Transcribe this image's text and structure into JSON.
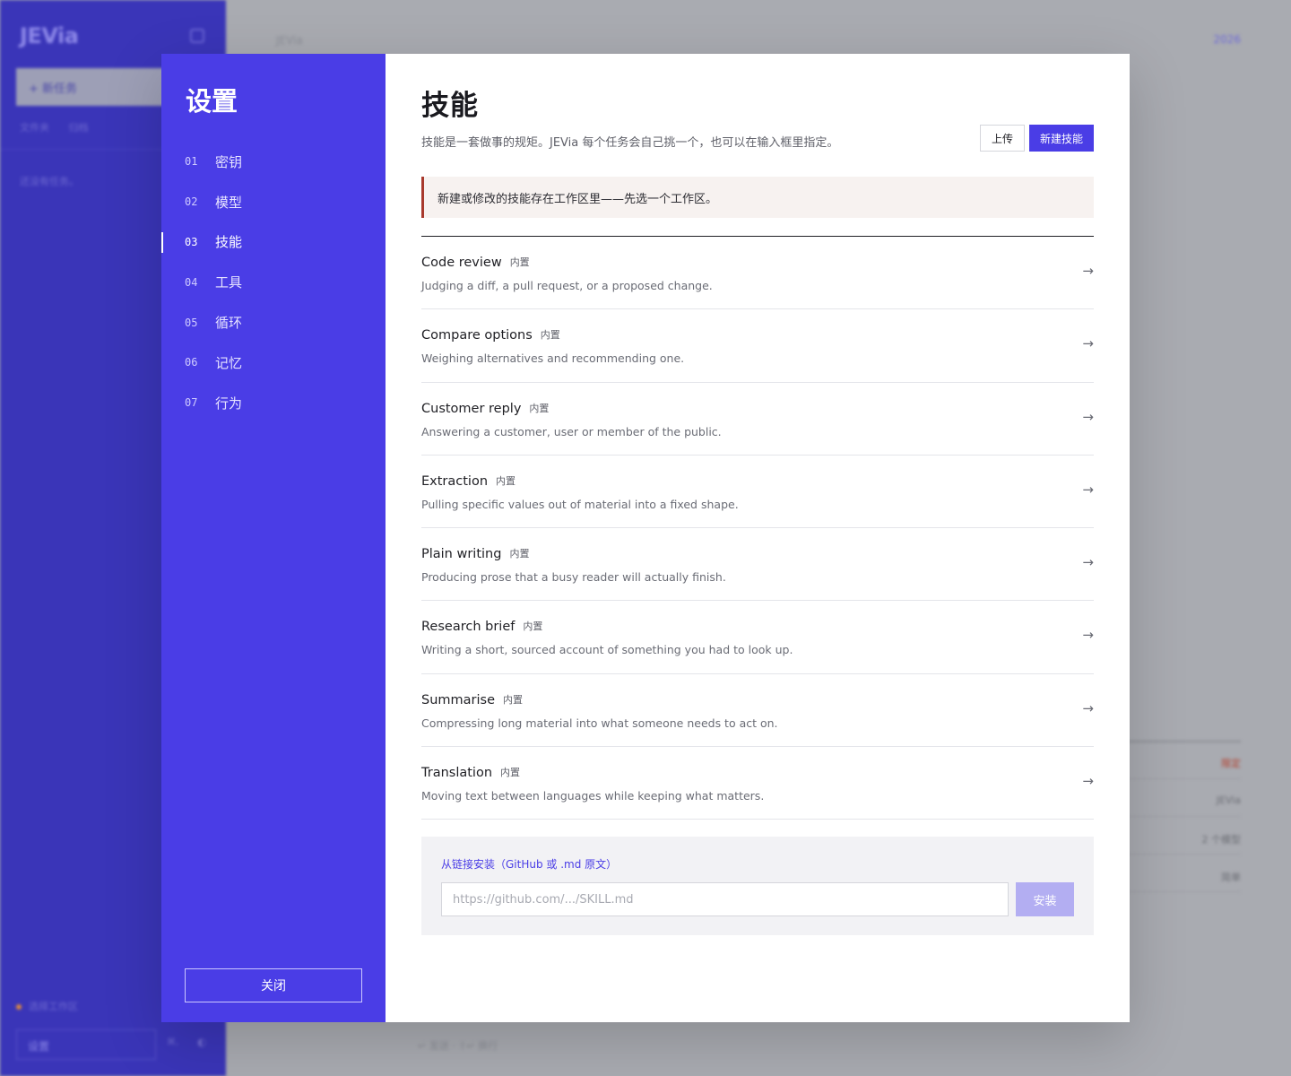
{
  "background": {
    "logo": "JEVia",
    "new_task": "+ 新任务",
    "links": [
      "文件夹",
      "归档"
    ],
    "hint": "还没有任务。",
    "workspace": "选择工作区",
    "settings": "设置",
    "shortcut": "⌘,",
    "small_icon": "◐",
    "breadcrumb": "JEVia",
    "top_right": "2026",
    "rows": [
      {
        "value": "限定",
        "color": "#b3402e"
      },
      {
        "value": "JEVia",
        "color": "#6b6d74"
      },
      {
        "value": "2 个模型",
        "color": "#6b6d74"
      },
      {
        "value": "简单",
        "color": "#6b6d74"
      }
    ],
    "footer": "↵ 发送 · ⇧↵ 换行"
  },
  "nav": {
    "title": "设置",
    "items": [
      {
        "num": "01",
        "label": "密钥"
      },
      {
        "num": "02",
        "label": "模型"
      },
      {
        "num": "03",
        "label": "技能"
      },
      {
        "num": "04",
        "label": "工具"
      },
      {
        "num": "05",
        "label": "循环"
      },
      {
        "num": "06",
        "label": "记忆"
      },
      {
        "num": "07",
        "label": "行为"
      }
    ],
    "active_index": 2,
    "close_label": "关闭"
  },
  "content": {
    "title": "技能",
    "description": "技能是一套做事的规矩。JEVia 每个任务会自己挑一个，也可以在输入框里指定。",
    "upload_label": "上传",
    "new_label": "新建技能",
    "notice": "新建或修改的技能存在工作区里——先选一个工作区。",
    "skills": [
      {
        "name": "Code review",
        "tag": "内置",
        "desc": "Judging a diff, a pull request, or a proposed change."
      },
      {
        "name": "Compare options",
        "tag": "内置",
        "desc": "Weighing alternatives and recommending one."
      },
      {
        "name": "Customer reply",
        "tag": "内置",
        "desc": "Answering a customer, user or member of the public."
      },
      {
        "name": "Extraction",
        "tag": "内置",
        "desc": "Pulling specific values out of material into a fixed shape."
      },
      {
        "name": "Plain writing",
        "tag": "内置",
        "desc": "Producing prose that a busy reader will actually finish."
      },
      {
        "name": "Research brief",
        "tag": "内置",
        "desc": "Writing a short, sourced account of something you had to look up."
      },
      {
        "name": "Summarise",
        "tag": "内置",
        "desc": "Compressing long material into what someone needs to act on."
      },
      {
        "name": "Translation",
        "tag": "内置",
        "desc": "Moving text between languages while keeping what matters."
      }
    ],
    "arrow": "→",
    "install": {
      "label": "从链接安装（GitHub 或 .md 原文）",
      "placeholder": "https://github.com/.../SKILL.md",
      "value": "",
      "button": "安装"
    }
  },
  "colors": {
    "accent": "#4a3de6",
    "accent_disabled": "#b3aef2",
    "notice_border": "#a8392d",
    "notice_bg": "#f7f2f0"
  }
}
